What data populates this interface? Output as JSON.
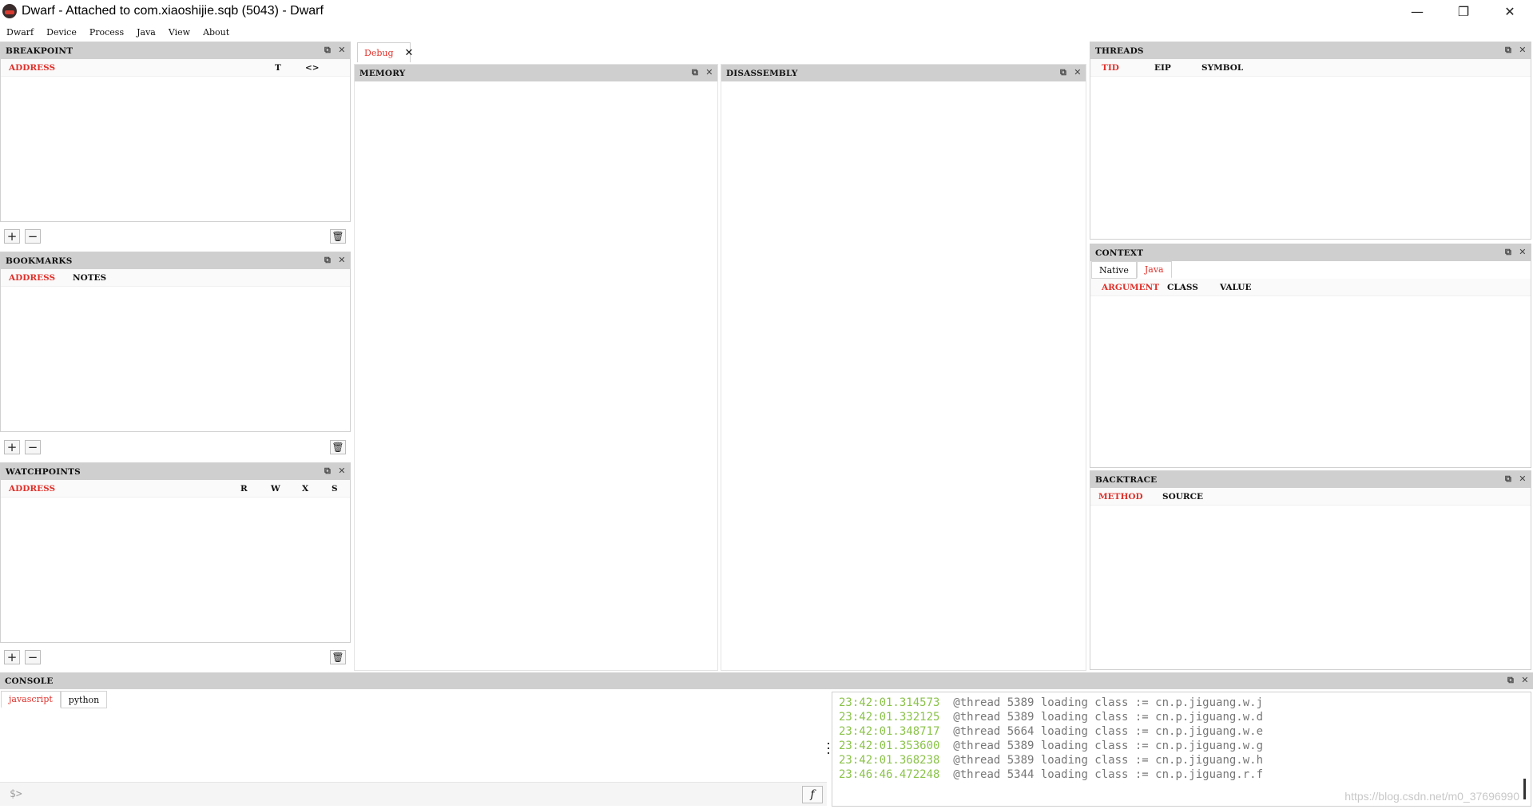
{
  "window": {
    "title": "Dwarf - Attached to com.xiaoshijie.sqb (5043) - Dwarf",
    "controls": {
      "minimize": "—",
      "restore": "❐",
      "close": "✕"
    }
  },
  "menu": [
    "Dwarf",
    "Device",
    "Process",
    "Java",
    "View",
    "About"
  ],
  "panel_icons": {
    "float": "⧉",
    "close": "✕",
    "add": "+",
    "remove": "−",
    "trash": "🗑"
  },
  "breakpoints": {
    "title": "BREAKPOINT",
    "columns": [
      "ADDRESS",
      "T",
      "<>"
    ]
  },
  "bookmarks": {
    "title": "BOOKMARKS",
    "columns": [
      "ADDRESS",
      "NOTES"
    ]
  },
  "watchpoints": {
    "title": "WATCHPOINTS",
    "columns": [
      "ADDRESS",
      "R",
      "W",
      "X",
      "S"
    ]
  },
  "debug_tab": {
    "label": "Debug",
    "close": "✕"
  },
  "memory": {
    "title": "MEMORY"
  },
  "disassembly": {
    "title": "DISASSEMBLY"
  },
  "threads": {
    "title": "THREADS",
    "columns": [
      "TID",
      "EIP",
      "SYMBOL"
    ]
  },
  "context": {
    "title": "CONTEXT",
    "tabs": [
      "Native",
      "Java"
    ],
    "active_tab": "Java",
    "columns": [
      "ARGUMENT",
      "CLASS",
      "VALUE"
    ]
  },
  "backtrace": {
    "title": "BACKTRACE",
    "columns": [
      "METHOD",
      "SOURCE"
    ]
  },
  "console": {
    "title": "CONSOLE",
    "tabs": [
      "javascript",
      "python"
    ],
    "active_tab": "javascript",
    "prompt": "$>",
    "input_value": "",
    "fn_button": "f",
    "log": [
      {
        "time": "23:42:01.314573",
        "msg": "@thread 5389 loading class := cn.p.jiguang.w.j"
      },
      {
        "time": "23:42:01.332125",
        "msg": "@thread 5389 loading class := cn.p.jiguang.w.d"
      },
      {
        "time": "23:42:01.348717",
        "msg": "@thread 5664 loading class := cn.p.jiguang.w.e"
      },
      {
        "time": "23:42:01.353600",
        "msg": "@thread 5389 loading class := cn.p.jiguang.w.g"
      },
      {
        "time": "23:42:01.368238",
        "msg": "@thread 5389 loading class := cn.p.jiguang.w.h"
      },
      {
        "time": "23:46:46.472248",
        "msg": "@thread 5344 loading class := cn.p.jiguang.r.f"
      }
    ],
    "watermark": "https://blog.csdn.net/m0_37696990"
  },
  "colors": {
    "accent": "#e0312b",
    "timestamp": "#8bc34a",
    "header_bg": "#cfcfcf"
  }
}
